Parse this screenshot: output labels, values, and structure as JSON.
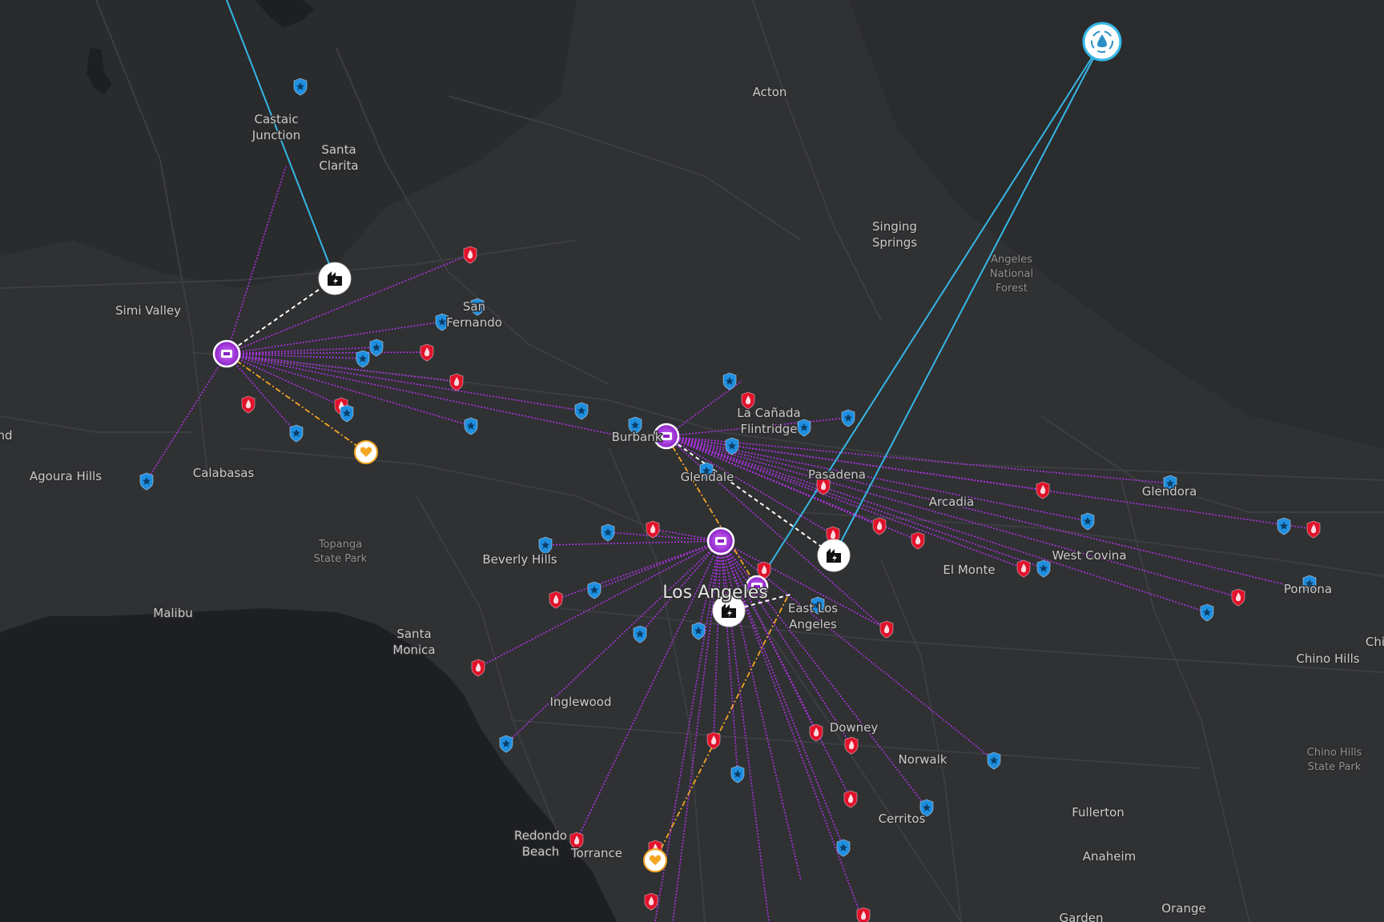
{
  "map": {
    "colors": {
      "land": "#303133",
      "ocean": "#1d1f22",
      "roads": "#3d3e41",
      "purple_link": "#b032e8",
      "blue_link": "#35b7e6",
      "orange_link": "#f5a623",
      "white_link": "#ffffff",
      "fire_marker": "#e1122b",
      "police_marker": "#1f8fe0",
      "medical_marker": "#f5a623"
    },
    "icons": {
      "fire": "fire-station-icon",
      "police": "police-station-icon",
      "medical": "medical-heart-icon",
      "power": "power-plant-icon",
      "water": "water-facility-icon",
      "hub": "dispatch-hub-icon"
    },
    "place_labels": [
      {
        "text": "Acton",
        "cls": ""
      },
      {
        "text": "Castaic",
        "cls": ""
      },
      {
        "text": "Junction",
        "cls": ""
      },
      {
        "text": "Santa",
        "cls": ""
      },
      {
        "text": "Clarita",
        "cls": ""
      },
      {
        "text": "Singing",
        "cls": ""
      },
      {
        "text": "Springs",
        "cls": ""
      },
      {
        "text": "Angeles",
        "cls": "park"
      },
      {
        "text": "National",
        "cls": "park"
      },
      {
        "text": "Forest",
        "cls": "park"
      },
      {
        "text": "Simi Valley",
        "cls": ""
      },
      {
        "text": "San",
        "cls": ""
      },
      {
        "text": "Fernando",
        "cls": ""
      },
      {
        "text": "nd",
        "cls": ""
      },
      {
        "text": "Agoura Hills",
        "cls": ""
      },
      {
        "text": "Calabasas",
        "cls": ""
      },
      {
        "text": "Burbank",
        "cls": ""
      },
      {
        "text": "La Cañada",
        "cls": ""
      },
      {
        "text": "Flintridge",
        "cls": ""
      },
      {
        "text": "Glendale",
        "cls": ""
      },
      {
        "text": "Pasadena",
        "cls": ""
      },
      {
        "text": "Arcadia",
        "cls": ""
      },
      {
        "text": "Glendora",
        "cls": ""
      },
      {
        "text": "Topanga",
        "cls": "park"
      },
      {
        "text": "State Park",
        "cls": "park"
      },
      {
        "text": "Beverly Hills",
        "cls": ""
      },
      {
        "text": "West Covina",
        "cls": ""
      },
      {
        "text": "El Monte",
        "cls": ""
      },
      {
        "text": "Pomona",
        "cls": ""
      },
      {
        "text": "Los Angeles",
        "cls": "big"
      },
      {
        "text": "East Los",
        "cls": ""
      },
      {
        "text": "Angeles",
        "cls": ""
      },
      {
        "text": "Malibu",
        "cls": ""
      },
      {
        "text": "Santa",
        "cls": ""
      },
      {
        "text": "Monica",
        "cls": ""
      },
      {
        "text": "Chi",
        "cls": ""
      },
      {
        "text": "Chino Hills",
        "cls": ""
      },
      {
        "text": "Inglewood",
        "cls": ""
      },
      {
        "text": "Downey",
        "cls": ""
      },
      {
        "text": "Norwalk",
        "cls": ""
      },
      {
        "text": "Chino Hills",
        "cls": "park"
      },
      {
        "text": "State Park",
        "cls": "park"
      },
      {
        "text": "Cerritos",
        "cls": ""
      },
      {
        "text": "Fullerton",
        "cls": ""
      },
      {
        "text": "Redondo",
        "cls": ""
      },
      {
        "text": "Beach",
        "cls": ""
      },
      {
        "text": "Torrance",
        "cls": ""
      },
      {
        "text": "Anaheim",
        "cls": ""
      },
      {
        "text": "Orange",
        "cls": ""
      },
      {
        "text": "Garden",
        "cls": ""
      }
    ]
  }
}
